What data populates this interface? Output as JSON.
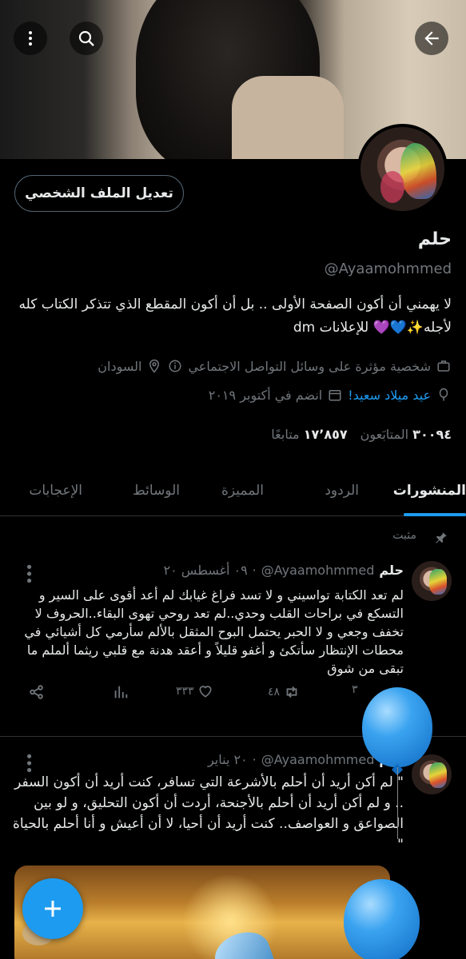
{
  "header": {
    "back_icon": "arrow-left-icon",
    "search_icon": "search-icon",
    "more_icon": "more-vertical-icon"
  },
  "profile": {
    "edit_button": "تعديل الملف الشخصي",
    "name": "حلم",
    "handle": "@Ayaamohmmed",
    "bio_line1": "لا يهمني أن أكون الصفحة الأولى .. بل أن أكون المقطع الذي تتذكر الكتاب كله",
    "bio_line2": "لأجله✨💙💜 للإعلانات dm",
    "category": "شخصية مؤثرة على وسائل التواصل الاجتماعي",
    "location": "السودان",
    "birthday": "عيد ميلاد سعيد!",
    "joined": "انضم في أكتوبر ٢٠١٩",
    "following_count": "١٧٬٨٥٧",
    "following_label": "متابعًا",
    "followers_count": "٣٠٠٩٤",
    "followers_label": "المتابَعون"
  },
  "tabs": [
    "المنشورات",
    "الردود",
    "المميزة",
    "الوسائط",
    "الإعجابات"
  ],
  "pinned_label": "مثبت",
  "tweets": [
    {
      "name": "حلم",
      "handle": "@Ayaamohmmed",
      "date": "٠٩ أغسطس ٢٠",
      "text": "لم تعد الكتابة تواسيني و لا تسد فراغ غيابك لم أعد أقوى على السير و التسكع في براحات القلب وحدي..لم تعد روحي تهوى البقاء..الحروف لا تخفف وجعي و لا الحبر يحتمل البوح المثقل بالألم سأرمي كل أشيائي في محطات الإنتظار سأتكئ و أغفو قليلاً و أعقد هدنة مع قلبي ريثما ألملم ما تبقى من شوق",
      "retweets": "٤٨",
      "likes": "٣٣٣",
      "replies": "٣"
    },
    {
      "name": "حلم",
      "handle": "@Ayaamohmmed",
      "date": "٢٠ يناير",
      "text": "\" لم أكن أريد أن أحلم بالأشرعة التي تسافر، كنت أريد أن أكون السفر .. و لم أكن أريد أن أحلم بالأجنحة، أردت أن أكون التحليق، و لو بين الصواعق و العواصف.. كنت أريد أن أحيا، لا أن أعيش و أنا أحلم بالحياة \""
    }
  ],
  "colors": {
    "accent": "#1d9bf0",
    "muted": "#71767b",
    "text": "#e7e9ea",
    "border": "#2f3336"
  }
}
